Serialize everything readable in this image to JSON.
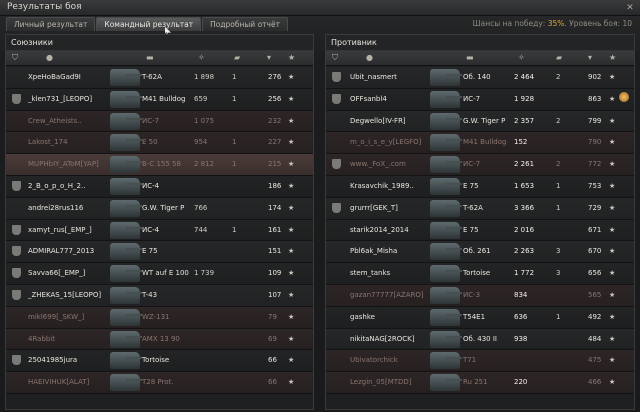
{
  "window": {
    "title": "Результаты боя",
    "close": "✕"
  },
  "tabs": [
    "Личный результат",
    "Командный результат",
    "Подробный отчёт"
  ],
  "stats": {
    "win_label": "Шансы на победу: ",
    "win_value": "35%",
    "level_label": ". Уровень боя: 10"
  },
  "allies": {
    "title": "Союзники",
    "rows": [
      {
        "name": "XpeHoBaGad9I",
        "vehicle": "T-62A",
        "damage": "1 898",
        "kills": "1",
        "xp": "276",
        "clan": false,
        "dead": false,
        "highlight": false
      },
      {
        "name": "_klen731_[LEOPO]",
        "vehicle": "M41 Bulldog",
        "damage": "659",
        "kills": "1",
        "xp": "256",
        "clan": true,
        "dead": false,
        "highlight": false
      },
      {
        "name": "Crew_Atheists..",
        "vehicle": "ИС-7",
        "damage": "1 075",
        "kills": "",
        "xp": "232",
        "clan": false,
        "dead": true,
        "highlight": false
      },
      {
        "name": "Lakost_174",
        "vehicle": "E 50",
        "damage": "954",
        "kills": "1",
        "xp": "227",
        "clan": false,
        "dead": true,
        "highlight": false
      },
      {
        "name": "MUPHbIY_AToM[YAP]",
        "vehicle": "B-C 155 58",
        "damage": "2 812",
        "kills": "1",
        "xp": "215",
        "clan": false,
        "dead": true,
        "highlight": true
      },
      {
        "name": "2_B_o_p_o_H_2..",
        "vehicle": "ИС-4",
        "damage": "",
        "kills": "",
        "xp": "186",
        "clan": true,
        "dead": false,
        "highlight": false
      },
      {
        "name": "andrei28rus116",
        "vehicle": "G.W. Tiger P",
        "damage": "766",
        "kills": "",
        "xp": "174",
        "clan": false,
        "dead": false,
        "highlight": false
      },
      {
        "name": "xamyt_rus[_EMP_]",
        "vehicle": "ИС-4",
        "damage": "744",
        "kills": "1",
        "xp": "161",
        "clan": true,
        "dead": false,
        "highlight": false
      },
      {
        "name": "ADMIRAL777_2013",
        "vehicle": "E 75",
        "damage": "",
        "kills": "",
        "xp": "151",
        "clan": true,
        "dead": false,
        "highlight": false
      },
      {
        "name": "Savva66[_EMP_]",
        "vehicle": "WT auf E 100",
        "damage": "1 739",
        "kills": "",
        "xp": "109",
        "clan": true,
        "dead": false,
        "highlight": false
      },
      {
        "name": "_ZHEKAS_15[LEOPO]",
        "vehicle": "T-43",
        "damage": "",
        "kills": "",
        "xp": "107",
        "clan": true,
        "dead": false,
        "highlight": false
      },
      {
        "name": "mikl699[_SKW_]",
        "vehicle": "WZ-131",
        "damage": "",
        "kills": "",
        "xp": "79",
        "clan": false,
        "dead": true,
        "highlight": false
      },
      {
        "name": "4Rabbit",
        "vehicle": "AMX 13 90",
        "damage": "",
        "kills": "",
        "xp": "69",
        "clan": false,
        "dead": true,
        "highlight": false
      },
      {
        "name": "25041985jura",
        "vehicle": "Tortoise",
        "damage": "",
        "kills": "",
        "xp": "66",
        "clan": true,
        "dead": false,
        "highlight": false
      },
      {
        "name": "HAEIVIHUK[ALAT]",
        "vehicle": "T28 Prot.",
        "damage": "",
        "kills": "",
        "xp": "66",
        "clan": false,
        "dead": true,
        "highlight": false
      }
    ]
  },
  "enemies": {
    "title": "Противник",
    "rows": [
      {
        "name": "Ubit_nasmert",
        "vehicle": "Об. 140",
        "damage": "2 464",
        "kills": "2",
        "xp": "902",
        "clan": true,
        "dead": false,
        "medal": false
      },
      {
        "name": "OFFsanbl4",
        "vehicle": "ИС-7",
        "damage": "1 928",
        "kills": "",
        "xp": "863",
        "clan": true,
        "dead": false,
        "medal": true
      },
      {
        "name": "Degwello[IV-FR]",
        "vehicle": "G.W. Tiger P",
        "damage": "2 357",
        "kills": "2",
        "xp": "799",
        "clan": false,
        "dead": false,
        "medal": false
      },
      {
        "name": "m_o_i_s_e_y[LEGFO]",
        "vehicle": "M41 Bulldog",
        "damage": "152",
        "kills": "",
        "xp": "790",
        "clan": false,
        "dead": true,
        "medal": false
      },
      {
        "name": "www._FoX_.com",
        "vehicle": "ИС-7",
        "damage": "2 261",
        "kills": "2",
        "xp": "772",
        "clan": true,
        "dead": true,
        "medal": false
      },
      {
        "name": "Krasavchik_1989..",
        "vehicle": "E 75",
        "damage": "1 653",
        "kills": "1",
        "xp": "753",
        "clan": false,
        "dead": false,
        "medal": false
      },
      {
        "name": "grurrr[GEK_T]",
        "vehicle": "T-62A",
        "damage": "3 366",
        "kills": "1",
        "xp": "729",
        "clan": true,
        "dead": false,
        "medal": false
      },
      {
        "name": "starik2014_2014",
        "vehicle": "E 75",
        "damage": "2 016",
        "kills": "",
        "xp": "671",
        "clan": false,
        "dead": false,
        "medal": false
      },
      {
        "name": "Pbl6ak_Misha",
        "vehicle": "Об. 261",
        "damage": "2 263",
        "kills": "3",
        "xp": "670",
        "clan": false,
        "dead": false,
        "medal": false
      },
      {
        "name": "stem_tanks",
        "vehicle": "Tortoise",
        "damage": "1 772",
        "kills": "3",
        "xp": "656",
        "clan": false,
        "dead": false,
        "medal": false
      },
      {
        "name": "gazan77777[AZARO]",
        "vehicle": "ИС-3",
        "damage": "834",
        "kills": "",
        "xp": "565",
        "clan": false,
        "dead": true,
        "medal": false
      },
      {
        "name": "gashke",
        "vehicle": "T54E1",
        "damage": "636",
        "kills": "1",
        "xp": "492",
        "clan": false,
        "dead": false,
        "medal": false
      },
      {
        "name": "nikitaNAG[2ROCK]",
        "vehicle": "Об. 430 II",
        "damage": "938",
        "kills": "",
        "xp": "484",
        "clan": false,
        "dead": false,
        "medal": false
      },
      {
        "name": "Ubivatorchick",
        "vehicle": "T71",
        "damage": "",
        "kills": "",
        "xp": "475",
        "clan": false,
        "dead": true,
        "medal": false
      },
      {
        "name": "Lezgin_05[MTDD]",
        "vehicle": "Ru 251",
        "damage": "220",
        "kills": "",
        "xp": "466",
        "clan": false,
        "dead": true,
        "medal": false
      }
    ]
  },
  "columns": {
    "star": "★",
    "sort": "▾"
  }
}
